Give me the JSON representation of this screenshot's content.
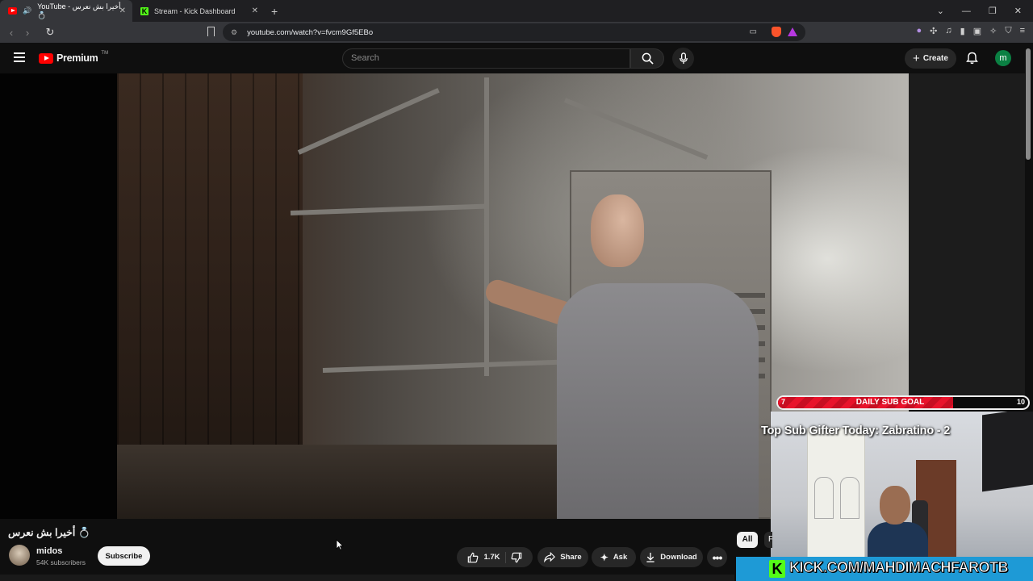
{
  "browser": {
    "tabs": [
      {
        "label": "YouTube - ‏أخيرا بش نعرس 💍",
        "active": true
      },
      {
        "label": "Stream - Kick Dashboard",
        "active": false
      }
    ],
    "new_tab_symbol": "+",
    "url": "youtube.com/watch?v=fvcm9Gf5EBo",
    "window_controls": [
      "⌄",
      "—",
      "❐",
      "✕"
    ]
  },
  "youtube": {
    "logo_text": "Premium",
    "logo_tm": "TM",
    "search_placeholder": "Search",
    "create_label": "Create",
    "avatar_letter": "m"
  },
  "video": {
    "title": "أخيرا بش نعرس 💍",
    "channel_name": "midos",
    "subscribers": "54K subscribers",
    "subscribe_label": "Subscribe",
    "like_count": "1.7K",
    "share_label": "Share",
    "ask_label": "Ask",
    "download_label": "Download"
  },
  "stream_overlay": {
    "goal_title": "DAILY SUB GOAL",
    "goal_current": "7",
    "goal_target": "10",
    "goal_progress": 0.7,
    "top_gifter": "Top Sub Gifter Today: Zabratino - 2",
    "kick_url": "KICK.COM/MAHDIMACHFAROTB",
    "kick_logo": "K"
  },
  "sidebar": {
    "chips": [
      "All",
      "F"
    ]
  }
}
